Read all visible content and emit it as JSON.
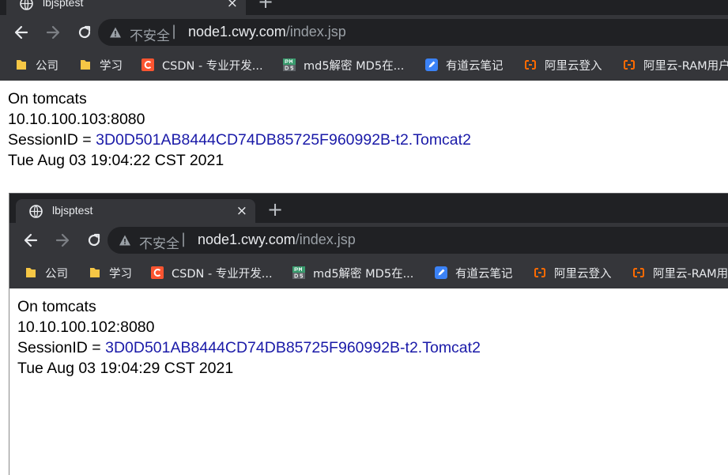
{
  "windows": [
    {
      "tab": {
        "title": "lbjsptest",
        "close_glyph": "×"
      },
      "new_tab_glyph": "+",
      "omnibox": {
        "security_label": "不安全",
        "separator": "|",
        "host": "node1.cwy.com",
        "path": "/index.jsp"
      },
      "bookmarks": [
        {
          "label": "公司",
          "icon": "folder-icon"
        },
        {
          "label": "学习",
          "icon": "folder-icon"
        },
        {
          "label": "CSDN - 专业开发...",
          "icon": "csdn-icon"
        },
        {
          "label": "md5解密 MD5在...",
          "icon": "pmd5-icon"
        },
        {
          "label": "有道云笔记",
          "icon": "youdao-icon"
        },
        {
          "label": "阿里云登入",
          "icon": "aliyun-icon"
        },
        {
          "label": "阿里云-RAM用户...",
          "icon": "aliyun-icon"
        }
      ],
      "page": {
        "line1": "On tomcats",
        "line2": "10.10.100.103:8080",
        "session_label": "SessionID = ",
        "session_id": "3D0D501AB8444CD74DB85725F960992B-t2.Tomcat2",
        "timestamp": "Tue Aug 03 19:04:22 CST 2021"
      }
    },
    {
      "tab": {
        "title": "lbjsptest",
        "close_glyph": "×"
      },
      "new_tab_glyph": "+",
      "omnibox": {
        "security_label": "不安全",
        "separator": "|",
        "host": "node1.cwy.com",
        "path": "/index.jsp"
      },
      "bookmarks": [
        {
          "label": "公司",
          "icon": "folder-icon"
        },
        {
          "label": "学习",
          "icon": "folder-icon"
        },
        {
          "label": "CSDN - 专业开发...",
          "icon": "csdn-icon"
        },
        {
          "label": "md5解密 MD5在...",
          "icon": "pmd5-icon"
        },
        {
          "label": "有道云笔记",
          "icon": "youdao-icon"
        },
        {
          "label": "阿里云登入",
          "icon": "aliyun-icon"
        },
        {
          "label": "阿里云-RAM用户...",
          "icon": "aliyun-icon"
        }
      ],
      "page": {
        "line1": "On tomcats",
        "line2": "10.10.100.102:8080",
        "session_label": "SessionID = ",
        "session_id": "3D0D501AB8444CD74DB85725F960992B-t2.Tomcat2",
        "timestamp": "Tue Aug 03 19:04:29 CST 2021"
      }
    }
  ],
  "colors": {
    "chrome_dark": "#202124",
    "chrome_toolbar": "#35363a",
    "text_light": "#e8eaed",
    "text_dim": "#9aa0a6",
    "session_link": "#1a1aa8",
    "folder": "#f6c745",
    "csdn": "#fc5531",
    "youdao": "#3b82f6",
    "aliyun": "#ff6a00"
  }
}
